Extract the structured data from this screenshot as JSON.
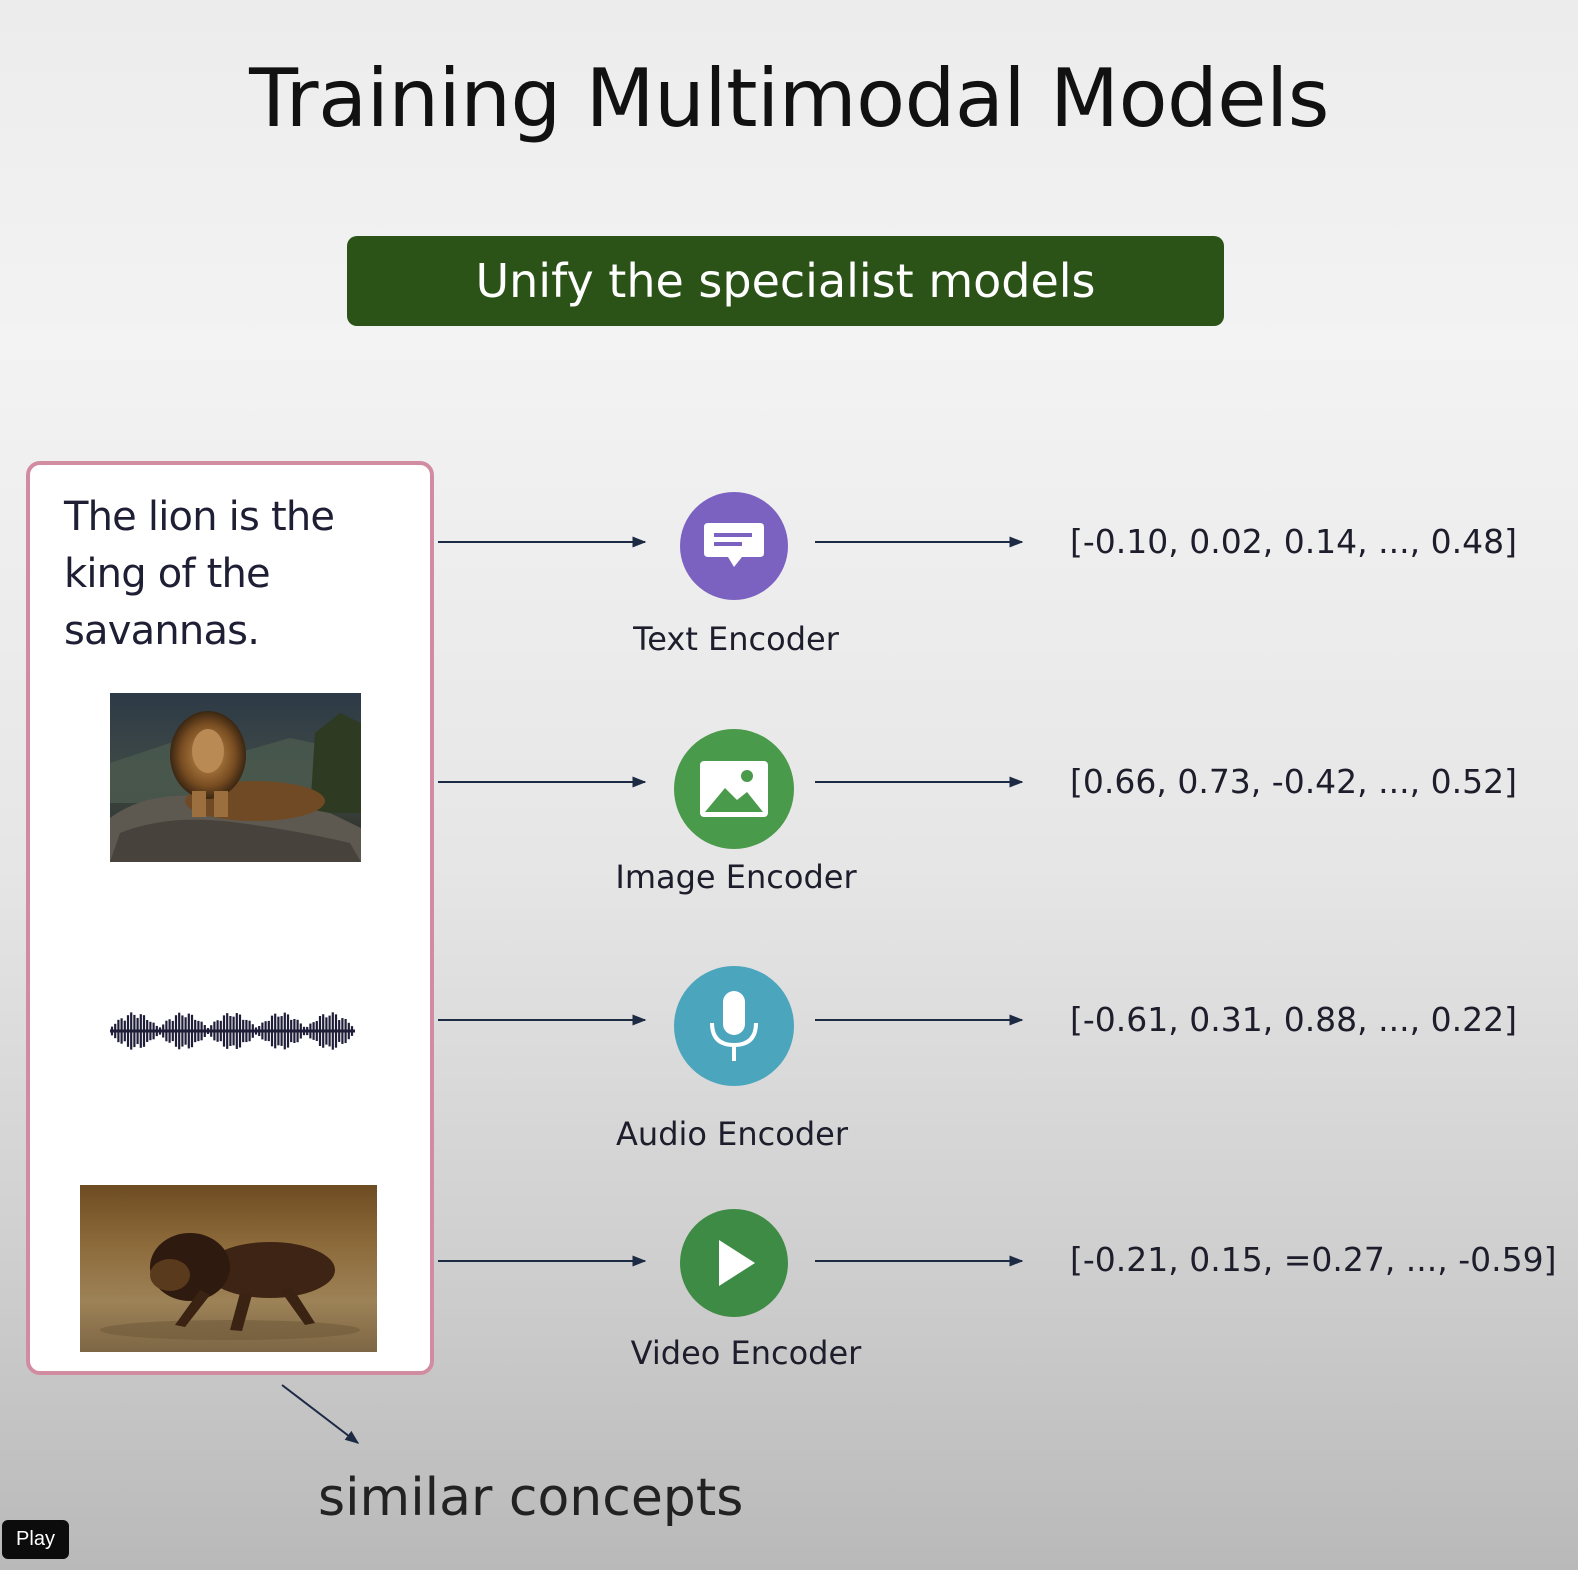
{
  "title": "Training Multimodal Models",
  "banner": "Unify the specialist models",
  "input_text": "The lion is the king of the savannas.",
  "encoders": [
    {
      "label": "Text Encoder",
      "icon": "chat-message-icon",
      "color": "#7b62c1",
      "vector": "[-0.10, 0.02, 0.14, ..., 0.48]"
    },
    {
      "label": "Image Encoder",
      "icon": "image-icon",
      "color": "#4a9a4c",
      "vector": "[0.66, 0.73, -0.42, ..., 0.52]"
    },
    {
      "label": "Audio Encoder",
      "icon": "microphone-icon",
      "color": "#4ba6bd",
      "vector": "[-0.61, 0.31, 0.88, ..., 0.22]"
    },
    {
      "label": "Video Encoder",
      "icon": "play-icon",
      "color": "#3e8b45",
      "vector": "[-0.21, 0.15, =0.27, ..., -0.59]"
    }
  ],
  "footer": "similar concepts",
  "play_button": "Play",
  "colors": {
    "banner": "#2b5318",
    "panel_border": "#d28ca2",
    "arrow": "#1d2a44"
  }
}
